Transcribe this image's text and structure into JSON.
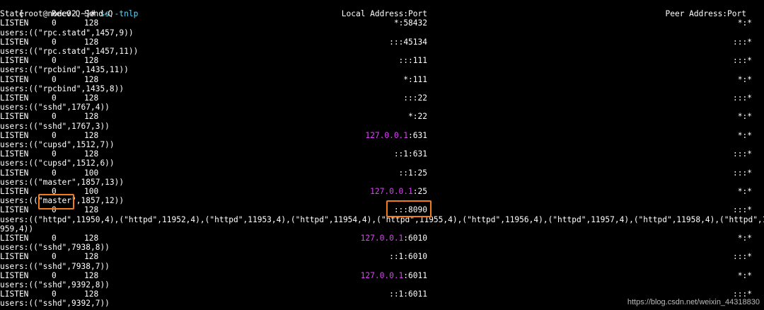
{
  "prompt": {
    "text": "[root@node02 ~]# ",
    "command": "ss -tnlp"
  },
  "header": {
    "state": "State",
    "recvq": "Recv-Q",
    "sendq": "Send-Q",
    "local": "Local Address:Port",
    "peer": "Peer Address:Port"
  },
  "rows": [
    {
      "state": "LISTEN",
      "recvq": "0",
      "sendq": "128",
      "local_host": "*",
      "local_sep": ":",
      "local_port": "58432",
      "peer": "*:*",
      "users": "users:((\"rpc.statd\",1457,9))"
    },
    {
      "state": "LISTEN",
      "recvq": "0",
      "sendq": "128",
      "local_host": "::",
      "local_sep": ":",
      "local_port": "45134",
      "peer": ":::*",
      "users": "users:((\"rpc.statd\",1457,11))"
    },
    {
      "state": "LISTEN",
      "recvq": "0",
      "sendq": "128",
      "local_host": "::",
      "local_sep": ":",
      "local_port": "111",
      "peer": ":::*",
      "users": "users:((\"rpcbind\",1435,11))"
    },
    {
      "state": "LISTEN",
      "recvq": "0",
      "sendq": "128",
      "local_host": "*",
      "local_sep": ":",
      "local_port": "111",
      "peer": "*:*",
      "users": "users:((\"rpcbind\",1435,8))"
    },
    {
      "state": "LISTEN",
      "recvq": "0",
      "sendq": "128",
      "local_host": "::",
      "local_sep": ":",
      "local_port": "22",
      "peer": ":::*",
      "users": "users:((\"sshd\",1767,4))"
    },
    {
      "state": "LISTEN",
      "recvq": "0",
      "sendq": "128",
      "local_host": "*",
      "local_sep": ":",
      "local_port": "22",
      "peer": "*:*",
      "users": "users:((\"sshd\",1767,3))"
    },
    {
      "state": "LISTEN",
      "recvq": "0",
      "sendq": "128",
      "local_host": "127.0.0.1",
      "local_sep": ":",
      "local_port": "631",
      "peer": "*:*",
      "users": "users:((\"cupsd\",1512,7))"
    },
    {
      "state": "LISTEN",
      "recvq": "0",
      "sendq": "128",
      "local_host": "::1",
      "local_sep": ":",
      "local_port": "631",
      "peer": ":::*",
      "users": "users:((\"cupsd\",1512,6))"
    },
    {
      "state": "LISTEN",
      "recvq": "0",
      "sendq": "100",
      "local_host": "::1",
      "local_sep": ":",
      "local_port": "25",
      "peer": ":::*",
      "users": "users:((\"master\",1857,13))"
    },
    {
      "state": "LISTEN",
      "recvq": "0",
      "sendq": "100",
      "local_host": "127.0.0.1",
      "local_sep": ":",
      "local_port": "25",
      "peer": "*:*",
      "users": "users:((\"master\",1857,12))"
    },
    {
      "state": "LISTEN",
      "recvq": "0",
      "sendq": "128",
      "local_host": "::",
      "local_sep": ":",
      "local_port": "8090",
      "peer": ":::*",
      "users": "users:((\"httpd\",11950,4),(\"httpd\",11952,4),(\"httpd\",11953,4),(\"httpd\",11954,4),(\"httpd\",11955,4),(\"httpd\",11956,4),(\"httpd\",11957,4),(\"httpd\",11958,4),(\"httpd\",11",
      "users_cont": "959,4))"
    },
    {
      "state": "LISTEN",
      "recvq": "0",
      "sendq": "128",
      "local_host": "127.0.0.1",
      "local_sep": ":",
      "local_port": "6010",
      "peer": "*:*",
      "users": "users:((\"sshd\",7938,8))"
    },
    {
      "state": "LISTEN",
      "recvq": "0",
      "sendq": "128",
      "local_host": "::1",
      "local_sep": ":",
      "local_port": "6010",
      "peer": ":::*",
      "users": "users:((\"sshd\",7938,7))"
    },
    {
      "state": "LISTEN",
      "recvq": "0",
      "sendq": "128",
      "local_host": "127.0.0.1",
      "local_sep": ":",
      "local_port": "6011",
      "peer": "*:*",
      "users": "users:((\"sshd\",9392,8))"
    },
    {
      "state": "LISTEN",
      "recvq": "0",
      "sendq": "128",
      "local_host": "::1",
      "local_sep": ":",
      "local_port": "6011",
      "peer": ":::*",
      "users": "users:((\"sshd\",9392,7))"
    }
  ],
  "colors": {
    "background": "#000000",
    "text": "#ffffff",
    "command": "#5fd7ff",
    "loopback": "#e040fb",
    "highlight": "#f07c1f"
  },
  "watermark": "https://blog.csdn.net/weixin_44318830"
}
